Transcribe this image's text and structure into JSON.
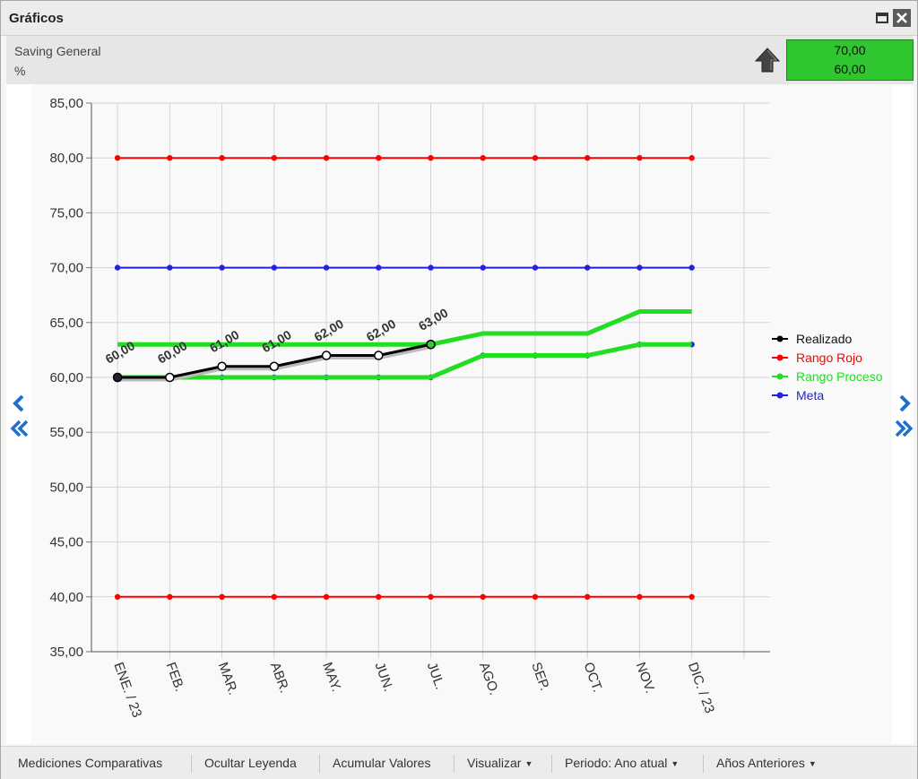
{
  "window": {
    "title": "Gráficos"
  },
  "indicator": {
    "name": "Saving General",
    "unit": "%",
    "value_top": "70,00",
    "value_bottom": "60,00",
    "status_color": "#2fc62f"
  },
  "toolbar": {
    "items": [
      {
        "label": "Mediciones Comparativas",
        "dropdown": false
      },
      {
        "label": "Ocultar Leyenda",
        "dropdown": false
      },
      {
        "label": "Acumular Valores",
        "dropdown": false
      },
      {
        "label": "Visualizar",
        "dropdown": true
      },
      {
        "label": "Periodo: Ano atual",
        "dropdown": true
      },
      {
        "label": "Años Anteriores",
        "dropdown": true
      }
    ]
  },
  "icons": [
    "restore-icon",
    "close-icon",
    "up-arrow-icon",
    "chevron-left-icon",
    "double-chevron-left-icon",
    "chevron-right-icon",
    "double-chevron-right-icon",
    "caret-down-icon"
  ],
  "chart_data": {
    "type": "line",
    "categories": [
      "ENE. / 23",
      "FEB.",
      "MAR.",
      "ABR.",
      "MAY.",
      "JUN.",
      "JUL.",
      "AGO.",
      "SEP.",
      "OCT.",
      "NOV.",
      "DIC. / 23"
    ],
    "ylim": [
      35,
      85
    ],
    "yticks": [
      "35,00",
      "40,00",
      "45,00",
      "50,00",
      "55,00",
      "60,00",
      "65,00",
      "70,00",
      "75,00",
      "80,00",
      "85,00"
    ],
    "grid": true,
    "legend_position": "right",
    "series": [
      {
        "name": "Realizado",
        "color": "#000000",
        "values": [
          60,
          60,
          61,
          61,
          62,
          62,
          63,
          null,
          null,
          null,
          null,
          null
        ],
        "labels": [
          "60,00",
          "60,00",
          "61,00",
          "61,00",
          "62,00",
          "62,00",
          "63,00"
        ]
      },
      {
        "name": "Rango Rojo",
        "color": "#ff0000",
        "values": [
          80,
          80,
          80,
          80,
          80,
          80,
          80,
          80,
          80,
          80,
          80,
          80
        ]
      },
      {
        "name": "Rango Rojo",
        "color": "#ff0000",
        "legend": false,
        "values": [
          40,
          40,
          40,
          40,
          40,
          40,
          40,
          40,
          40,
          40,
          40,
          40
        ]
      },
      {
        "name": "Rango Proceso",
        "color": "#22dd22",
        "values": [
          63,
          63,
          63,
          63,
          63,
          63,
          63,
          64,
          64,
          64,
          66,
          66
        ]
      },
      {
        "name": "Rango Proceso",
        "color": "#22dd22",
        "legend": false,
        "values": [
          60,
          60,
          60,
          60,
          60,
          60,
          60,
          62,
          62,
          62,
          63,
          63
        ]
      },
      {
        "name": "Meta",
        "color": "#2222dd",
        "values": [
          70,
          70,
          70,
          70,
          70,
          70,
          70,
          70,
          70,
          70,
          70,
          70
        ]
      },
      {
        "name": "Meta",
        "color": "#2222dd",
        "legend": false,
        "values": [
          60,
          60,
          60,
          60,
          60,
          60,
          60,
          62,
          62,
          62,
          63,
          63
        ]
      }
    ]
  }
}
